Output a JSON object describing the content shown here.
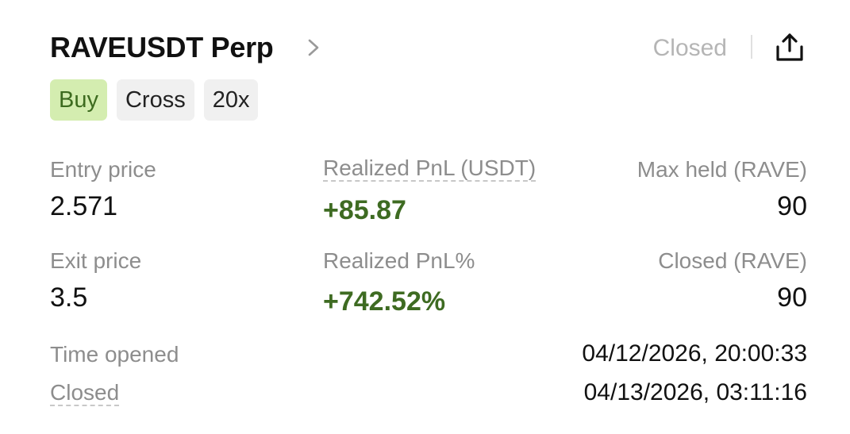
{
  "header": {
    "symbol": "RAVEUSDT Perp",
    "status": "Closed"
  },
  "tags": {
    "side": "Buy",
    "margin_mode": "Cross",
    "leverage": "20x"
  },
  "stats": {
    "entry_price_label": "Entry price",
    "entry_price_value": "2.571",
    "realized_pnl_label": "Realized PnL (USDT)",
    "realized_pnl_value": "+85.87",
    "max_held_label": "Max held (RAVE)",
    "max_held_value": "90",
    "exit_price_label": "Exit price",
    "exit_price_value": "3.5",
    "realized_pnl_pct_label": "Realized PnL%",
    "realized_pnl_pct_value": "+742.52%",
    "closed_qty_label": "Closed (RAVE)",
    "closed_qty_value": "90"
  },
  "times": {
    "opened_label": "Time opened",
    "opened_value": "04/12/2026, 20:00:33",
    "closed_label": "Closed",
    "closed_value": "04/13/2026, 03:11:16"
  },
  "colors": {
    "positive": "#3e6b22",
    "buy_tag_bg": "#d4edb0",
    "muted_text": "#8d8d8d",
    "status_text": "#b5b5b5"
  },
  "icons": {
    "detail": "chevron-right-icon",
    "share": "share-icon"
  }
}
